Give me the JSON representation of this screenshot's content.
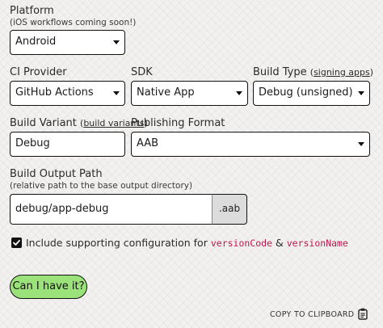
{
  "platform": {
    "label": "Platform",
    "sublabel": "(iOS workflows coming soon!)",
    "value": "Android"
  },
  "ci_provider": {
    "label": "CI Provider",
    "value": "GitHub Actions"
  },
  "sdk": {
    "label": "SDK",
    "value": "Native App"
  },
  "build_type": {
    "label": "Build Type",
    "link": "signing apps",
    "value": "Debug (unsigned)"
  },
  "build_variant": {
    "label": "Build Variant",
    "link": "build variants",
    "value": "Debug"
  },
  "publishing_format": {
    "label": "Publishing Format",
    "value": "AAB"
  },
  "build_output": {
    "label": "Build Output Path",
    "sublabel": "(relative path to the base output directory)",
    "value": "debug/app-debug",
    "suffix": ".aab"
  },
  "include_config": {
    "checked": true,
    "text_before": "Include supporting configuration for",
    "code1": "versionCode",
    "amp": "&",
    "code2": "versionName"
  },
  "cta_label": "Can I have it?",
  "copy_label": "COPY TO CLIPBOARD",
  "colors": {
    "cta": "#9be27a",
    "code": "#c0164e",
    "checkbox": "#111111"
  },
  "icons": {
    "dropdown": "caret-down-icon",
    "checkbox": "check-icon",
    "clipboard": "clipboard-icon"
  }
}
